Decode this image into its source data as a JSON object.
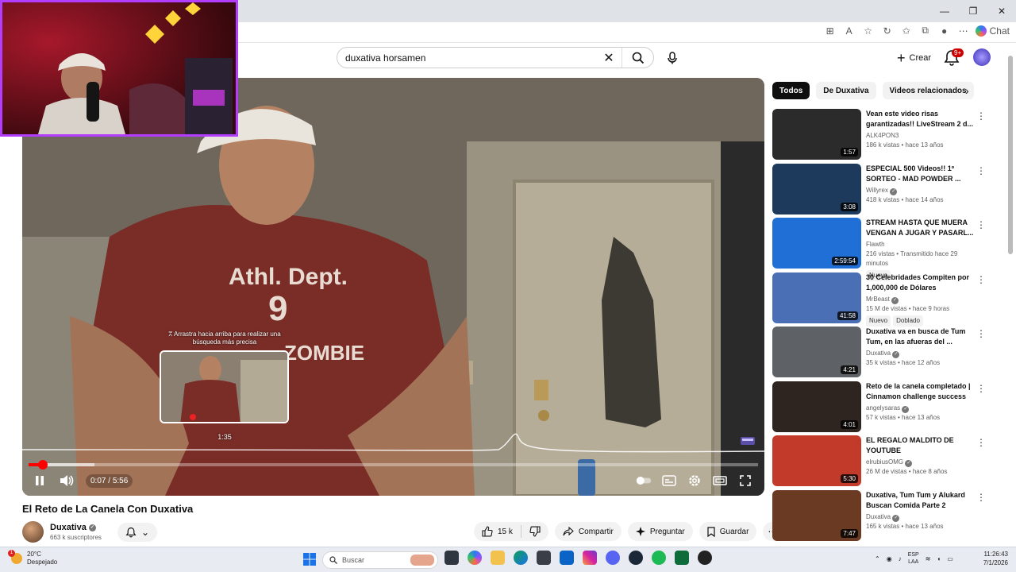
{
  "search": {
    "query": "duxativa horsamen"
  },
  "header": {
    "create_label": "Crear",
    "notif_count": "9+"
  },
  "browser": {
    "chat_label": "Chat"
  },
  "player": {
    "current_time": "0:07",
    "separator": " / ",
    "duration": "5:56",
    "hover_hint": "⩞ Arrastra hacia arriba para realizar una búsqueda más precisa",
    "hover_time": "1:35",
    "progress_played_fraction": 0.02,
    "progress_buffered_fraction": 0.09,
    "hover_fraction": 0.27
  },
  "video": {
    "title": "El Reto de La Canela Con Duxativa",
    "channel": "Duxativa",
    "subscribers": "663 k suscriptores",
    "likes": "15 k",
    "share_label": "Compartir",
    "ask_label": "Preguntar",
    "save_label": "Guardar"
  },
  "chips": [
    "Todos",
    "De Duxativa",
    "Videos relacionados"
  ],
  "recommendations": [
    {
      "title": "Vean este video risas garantizadas!! LiveStream 2 d...",
      "channel": "ALK4PON3",
      "verified": false,
      "meta": "186 k vistas • hace 13 años",
      "duration": "1:57",
      "badges": [],
      "thumb": "#2b2b2b"
    },
    {
      "title": "ESPECIAL 500 Videos!! 1º SORTEO - MAD POWDER ...",
      "channel": "Willyrex",
      "verified": true,
      "meta": "418 k vistas • hace 14 años",
      "duration": "3:08",
      "badges": [],
      "thumb": "#1d3a5c"
    },
    {
      "title": "STREAM HASTA QUE MUERA VENGAN A JUGAR Y PASARL...",
      "channel": "Flawth",
      "verified": false,
      "meta": "216 vistas • Transmitido hace 29 minutos",
      "duration": "2:59:54",
      "badges": [
        "Nuevo"
      ],
      "thumb": "#1f6fd6"
    },
    {
      "title": "30 Celebridades Compiten por 1,000,000 de Dólares",
      "channel": "MrBeast",
      "verified": true,
      "meta": "15 M de vistas • hace 9 horas",
      "duration": "41:58",
      "badges": [
        "Nuevo",
        "Doblado"
      ],
      "thumb": "#4a6fb5"
    },
    {
      "title": "Duxativa va en busca de Tum Tum, en las afueras del ...",
      "channel": "Duxativa",
      "verified": true,
      "meta": "35 k vistas • hace 12 años",
      "duration": "4:21",
      "badges": [],
      "thumb": "#5e6166"
    },
    {
      "title": "Reto de la canela completado | Cinnamon challenge success",
      "channel": "angelysaras",
      "verified": true,
      "meta": "57 k vistas • hace 13 años",
      "duration": "4:01",
      "badges": [],
      "thumb": "#2e2420"
    },
    {
      "title": "EL REGALO MALDITO DE YOUTUBE",
      "channel": "elrubiusOMG",
      "verified": true,
      "meta": "26 M de vistas • hace 8 años",
      "duration": "5:30",
      "badges": [],
      "thumb": "#c23b2a"
    },
    {
      "title": "Duxativa, Tum Tum y Alukard Buscan Comida Parte 2",
      "channel": "Duxativa",
      "verified": true,
      "meta": "165 k vistas • hace 13 años",
      "duration": "7:47",
      "badges": [],
      "thumb": "#6b3a22"
    }
  ],
  "taskbar": {
    "temp": "20°C",
    "weather": "Despejado",
    "search_placeholder": "Buscar",
    "lang_top": "ESP",
    "lang_bottom": "LAA",
    "time": "11:26:43",
    "date": "7/1/2026",
    "weather_alert": "1"
  },
  "colors": {
    "accent_red": "#ff0000",
    "webcam_border": "#b23dfc",
    "dark_chip": "#0f0f0f"
  }
}
